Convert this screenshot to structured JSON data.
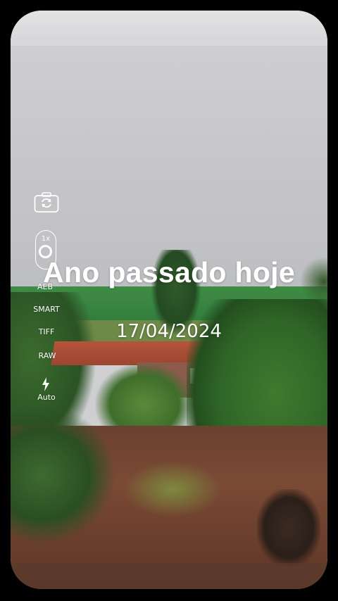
{
  "overlay": {
    "title": "Ano passado hoje",
    "date": "17/04/2024"
  },
  "camera_controls": {
    "switch_camera_icon": "camera-switch-icon",
    "zoom_label": "1x",
    "modes": [
      "AEB",
      "SMART",
      "TIFF",
      "RAW"
    ],
    "flash_icon": "flash-icon",
    "flash_label": "Auto"
  },
  "colors": {
    "text": "#ffffff",
    "frame_background": "#000000"
  }
}
